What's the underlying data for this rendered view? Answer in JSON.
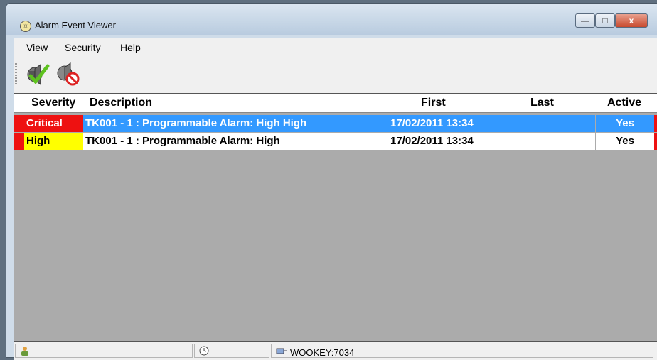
{
  "window": {
    "title": "Alarm Event Viewer",
    "close_glyph": "x",
    "max_glyph": "□",
    "min_glyph": "—"
  },
  "menu": [
    {
      "label": "View"
    },
    {
      "label": "Security"
    },
    {
      "label": "Help"
    }
  ],
  "toolbar": [
    {
      "icon": "acknowledge-sound-icon"
    },
    {
      "icon": "mute-sound-icon"
    }
  ],
  "grid": {
    "columns": [
      "Severity",
      "Description",
      "First",
      "Last",
      "Active"
    ],
    "rows": [
      {
        "severity": "Critical",
        "description": "TK001 - 1 : Programmable Alarm: High High",
        "first": "17/02/2011 13:34",
        "last": "",
        "active": "Yes",
        "selected": true
      },
      {
        "severity": "High",
        "description": "TK001 - 1 : Programmable Alarm: High",
        "first": "17/02/2011 13:34",
        "last": "",
        "active": "Yes",
        "selected": false
      }
    ]
  },
  "statusbar": {
    "server": "WOOKEY:7034"
  },
  "colors": {
    "critical": "#ee1111",
    "high": "#ffff00",
    "selection": "#3399ff",
    "grid_background": "#ababab"
  }
}
